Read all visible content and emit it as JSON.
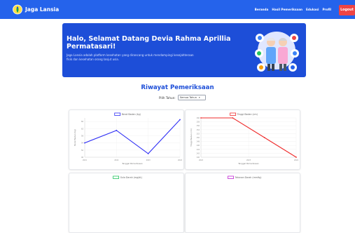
{
  "app": {
    "brand": "Jaga Lansia",
    "nav": [
      "Beranda",
      "Hasil Pemeriksaan",
      "Edukasi",
      "Profil"
    ],
    "logout": "Logout"
  },
  "hero": {
    "title": "Halo, Selamat Datang Devia Rahma Aprillia Permatasari!",
    "description": "Jaga Lansia adalah platform kesehatan yang dirancang untuk mendampingi kesejahteraan fisik dan kesehatan orang lanjut usia."
  },
  "section": {
    "title": "Riwayat Pemeriksaan",
    "filter_label": "Pilih Tahun:",
    "filter_value": "Semua Tahun"
  },
  "colors": {
    "primary": "#2563eb",
    "logout": "#ef4444",
    "blue_series": "#2f2ff5",
    "red_series": "#ef2b2b",
    "green_series": "#22c55e",
    "purple_series": "#c026d3"
  },
  "chart_data": [
    {
      "type": "line",
      "series": [
        {
          "name": "Berat Badan (kg)",
          "values": [
            54,
            61,
            48,
            67
          ],
          "color": "#2f2ff5"
        }
      ],
      "x": [
        "2021",
        "2022",
        "2023",
        "2024"
      ],
      "ylabel": "Berat Badan (kg)",
      "xlabel": "Tanggal Pemeriksaan",
      "yticks": [
        "46",
        "50",
        "54",
        "58",
        "62",
        "66"
      ],
      "ylim": [
        46,
        68
      ]
    },
    {
      "type": "line",
      "series": [
        {
          "name": "Tinggi Badan (cm)",
          "values": [
            160,
            160,
            150,
            140
          ],
          "color": "#ef2b2b"
        }
      ],
      "x": [
        "2022",
        "2023",
        "2024"
      ],
      "xvals": [
        0,
        1,
        2,
        3
      ],
      "ylabel": "Tinggi Badan (cm)",
      "xlabel": "Tanggal Pemeriksaan",
      "yticks": [
        "140",
        "142",
        "144",
        "146",
        "148",
        "150",
        "152",
        "154",
        "156",
        "158",
        "160"
      ],
      "ylim": [
        140,
        160
      ]
    },
    {
      "type": "line",
      "series": [
        {
          "name": "Gula Darah (mg/dL)",
          "values": [],
          "color": "#22c55e"
        }
      ]
    },
    {
      "type": "line",
      "series": [
        {
          "name": "Tekanan Darah (mmHg)",
          "values": [],
          "color": "#c026d3"
        }
      ]
    }
  ]
}
